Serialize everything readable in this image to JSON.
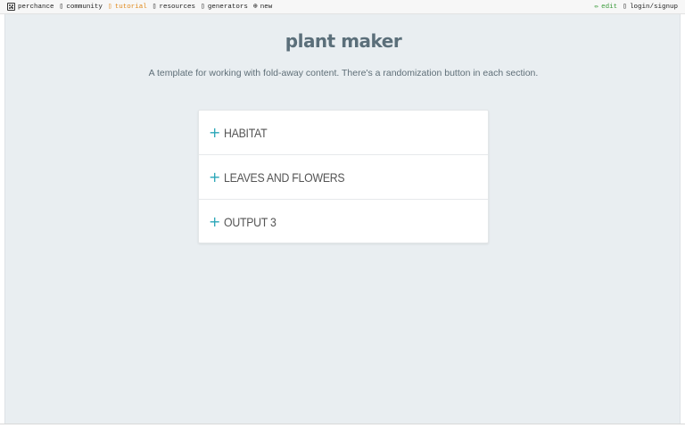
{
  "nav": {
    "left": [
      {
        "label": "perchance",
        "icon": "dice-icon"
      },
      {
        "label": "community",
        "icon": "chat-icon"
      },
      {
        "label": "tutorial",
        "icon": "book-icon"
      },
      {
        "label": "resources",
        "icon": "folder-icon"
      },
      {
        "label": "generators",
        "icon": "grid-icon"
      },
      {
        "label": "new",
        "icon": "plus-circle-icon"
      }
    ],
    "right": [
      {
        "label": "edit",
        "icon": "pencil-icon"
      },
      {
        "label": "login/signup",
        "icon": "user-icon"
      }
    ]
  },
  "page": {
    "title": "plant maker",
    "subtitle": "A template for working with fold-away content. There's a randomization button in each section."
  },
  "sections": [
    {
      "label": "HABITAT"
    },
    {
      "label": "LEAVES AND FLOWERS"
    },
    {
      "label": "OUTPUT 3"
    }
  ],
  "colors": {
    "accent": "#2aa6b8",
    "title": "#5b6f7a",
    "background": "#e9eef1",
    "active_nav": "#e08a1e",
    "edit": "#3a9a3a"
  }
}
